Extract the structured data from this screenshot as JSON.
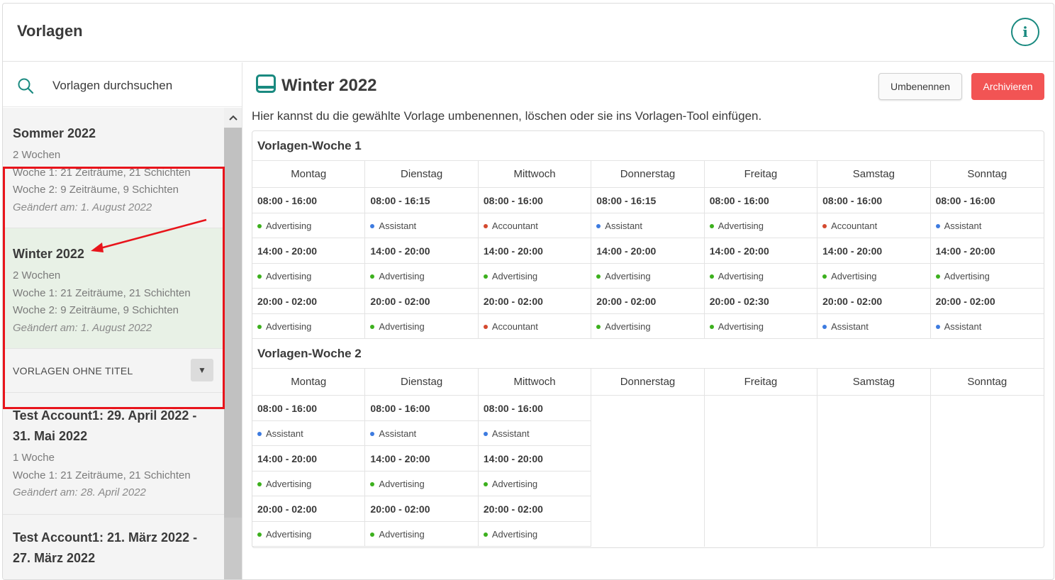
{
  "header": {
    "title": "Vorlagen",
    "info_label": "i"
  },
  "search": {
    "placeholder": "Vorlagen durchsuchen"
  },
  "templates": [
    {
      "title": "Sommer 2022",
      "weeks": "2 Wochen",
      "lines": [
        "Woche 1: 21 Zeiträume, 21 Schichten",
        "Woche 2: 9 Zeiträume, 9 Schichten"
      ],
      "changed": "Geändert am: 1. August 2022"
    },
    {
      "title": "Winter 2022",
      "weeks": "2 Wochen",
      "lines": [
        "Woche 1: 21 Zeiträume, 21 Schichten",
        "Woche 2: 9 Zeiträume, 9 Schichten"
      ],
      "changed": "Geändert am: 1. August 2022"
    }
  ],
  "section": {
    "label": "VORLAGEN OHNE TITEL"
  },
  "untitled_templates": [
    {
      "title": "Test Account1: 29. April 2022 - 31. Mai 2022",
      "weeks": "1 Woche",
      "lines": [
        "Woche 1: 21 Zeiträume, 21 Schichten"
      ],
      "changed": "Geändert am: 28. April 2022"
    },
    {
      "title": "Test Account1: 21. März 2022 - 27. März 2022"
    }
  ],
  "main": {
    "title": "Winter 2022",
    "rename_label": "Umbenennen",
    "archive_label": "Archivieren",
    "description": "Hier kannst du die gewählte Vorlage umbenennen, löschen oder sie ins Vorlagen-Tool einfügen."
  },
  "role_colors": {
    "Advertising": "#3cb01d",
    "Assistant": "#3d7be0",
    "Accountant": "#d4492f"
  },
  "weeks": [
    {
      "title": "Vorlagen-Woche 1",
      "days": [
        {
          "name": "Montag",
          "shifts": [
            {
              "time": "08:00 - 16:00",
              "role": "Advertising"
            },
            {
              "time": "14:00 - 20:00",
              "role": "Advertising"
            },
            {
              "time": "20:00 - 02:00",
              "role": "Advertising"
            }
          ]
        },
        {
          "name": "Dienstag",
          "shifts": [
            {
              "time": "08:00 - 16:15",
              "role": "Assistant"
            },
            {
              "time": "14:00 - 20:00",
              "role": "Advertising"
            },
            {
              "time": "20:00 - 02:00",
              "role": "Advertising"
            }
          ]
        },
        {
          "name": "Mittwoch",
          "shifts": [
            {
              "time": "08:00 - 16:00",
              "role": "Accountant"
            },
            {
              "time": "14:00 - 20:00",
              "role": "Advertising"
            },
            {
              "time": "20:00 - 02:00",
              "role": "Accountant"
            }
          ]
        },
        {
          "name": "Donnerstag",
          "shifts": [
            {
              "time": "08:00 - 16:15",
              "role": "Assistant"
            },
            {
              "time": "14:00 - 20:00",
              "role": "Advertising"
            },
            {
              "time": "20:00 - 02:00",
              "role": "Advertising"
            }
          ]
        },
        {
          "name": "Freitag",
          "shifts": [
            {
              "time": "08:00 - 16:00",
              "role": "Advertising"
            },
            {
              "time": "14:00 - 20:00",
              "role": "Advertising"
            },
            {
              "time": "20:00 - 02:30",
              "role": "Advertising"
            }
          ]
        },
        {
          "name": "Samstag",
          "shifts": [
            {
              "time": "08:00 - 16:00",
              "role": "Accountant"
            },
            {
              "time": "14:00 - 20:00",
              "role": "Advertising"
            },
            {
              "time": "20:00 - 02:00",
              "role": "Assistant"
            }
          ]
        },
        {
          "name": "Sonntag",
          "shifts": [
            {
              "time": "08:00 - 16:00",
              "role": "Assistant"
            },
            {
              "time": "14:00 - 20:00",
              "role": "Advertising"
            },
            {
              "time": "20:00 - 02:00",
              "role": "Assistant"
            }
          ]
        }
      ]
    },
    {
      "title": "Vorlagen-Woche 2",
      "days": [
        {
          "name": "Montag",
          "shifts": [
            {
              "time": "08:00 - 16:00",
              "role": "Assistant"
            },
            {
              "time": "14:00 - 20:00",
              "role": "Advertising"
            },
            {
              "time": "20:00 - 02:00",
              "role": "Advertising"
            }
          ]
        },
        {
          "name": "Dienstag",
          "shifts": [
            {
              "time": "08:00 - 16:00",
              "role": "Assistant"
            },
            {
              "time": "14:00 - 20:00",
              "role": "Advertising"
            },
            {
              "time": "20:00 - 02:00",
              "role": "Advertising"
            }
          ]
        },
        {
          "name": "Mittwoch",
          "shifts": [
            {
              "time": "08:00 - 16:00",
              "role": "Assistant"
            },
            {
              "time": "14:00 - 20:00",
              "role": "Advertising"
            },
            {
              "time": "20:00 - 02:00",
              "role": "Advertising"
            }
          ]
        },
        {
          "name": "Donnerstag",
          "shifts": []
        },
        {
          "name": "Freitag",
          "shifts": []
        },
        {
          "name": "Samstag",
          "shifts": []
        },
        {
          "name": "Sonntag",
          "shifts": []
        }
      ]
    }
  ]
}
